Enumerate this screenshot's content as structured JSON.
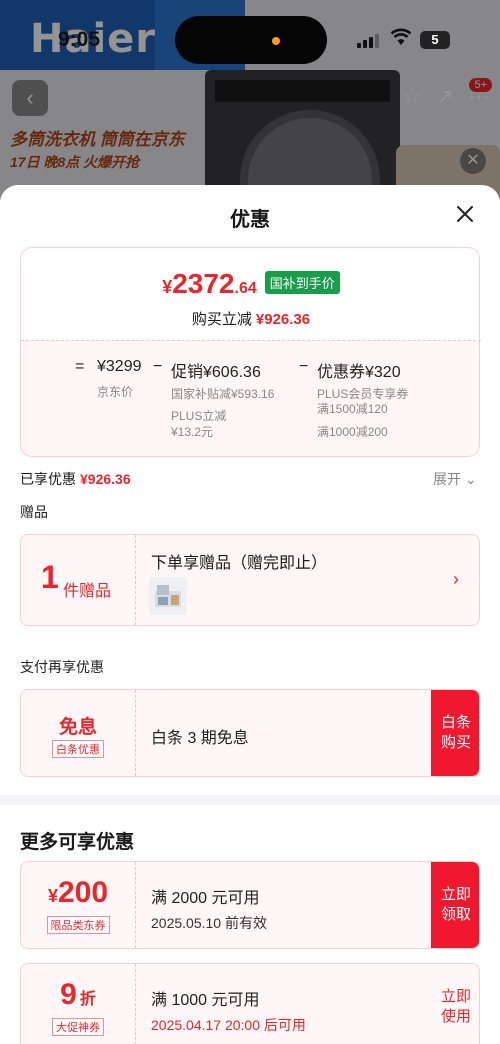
{
  "status_bar": {
    "time": "9:05",
    "battery": "5"
  },
  "background": {
    "brand": "Haier",
    "promo_line1": "多筒洗衣机 筒筒在京东",
    "promo_line2": "17日 晚8点 火爆开抢",
    "cart_badge": "5+"
  },
  "sheet": {
    "title": "优惠",
    "price": {
      "symbol": "¥",
      "integer": "2372",
      "decimal": ".64",
      "tag": "国补到手价"
    },
    "reduce_label": "购买立减",
    "reduce_value": "¥926.36",
    "formula": {
      "eq": "=",
      "jd_price": "¥3299",
      "jd_price_label": "京东价",
      "minus1": "−",
      "promo": "促销¥606.36",
      "promo_sub1": "国家补贴减¥593.16",
      "promo_sub2a": "PLUS立减",
      "promo_sub2b": "¥13.2元",
      "minus2": "−",
      "coupon": "优惠券¥320",
      "coupon_sub1": "PLUS会员专享券",
      "coupon_sub2": "满1500减120",
      "coupon_sub3": "满1000减200"
    },
    "enjoyed_label": "已享优惠",
    "enjoyed_value": "¥926.36",
    "expand_label": "展开",
    "gift_section": "赠品",
    "gift": {
      "count": "1",
      "unit": "件赠品",
      "text": "下单享赠品（赠完即止）"
    },
    "pay_section": "支付再享优惠",
    "pay": {
      "main": "免息",
      "tag": "白条优惠",
      "text": "白条 3 期免息",
      "button": "白条购买"
    },
    "more_title": "更多可享优惠",
    "coupons": [
      {
        "symbol": "¥",
        "value": "200",
        "tag": "限品类东券",
        "text": "满 2000 元可用",
        "date": "2025.05.10 前有效",
        "button": "立即领取"
      },
      {
        "value": "9",
        "unit": "折",
        "tag": "大促神券",
        "text": "满 1000 元可用",
        "date": "2025.04.17 20:00 后可用",
        "button": "立即使用"
      }
    ]
  }
}
